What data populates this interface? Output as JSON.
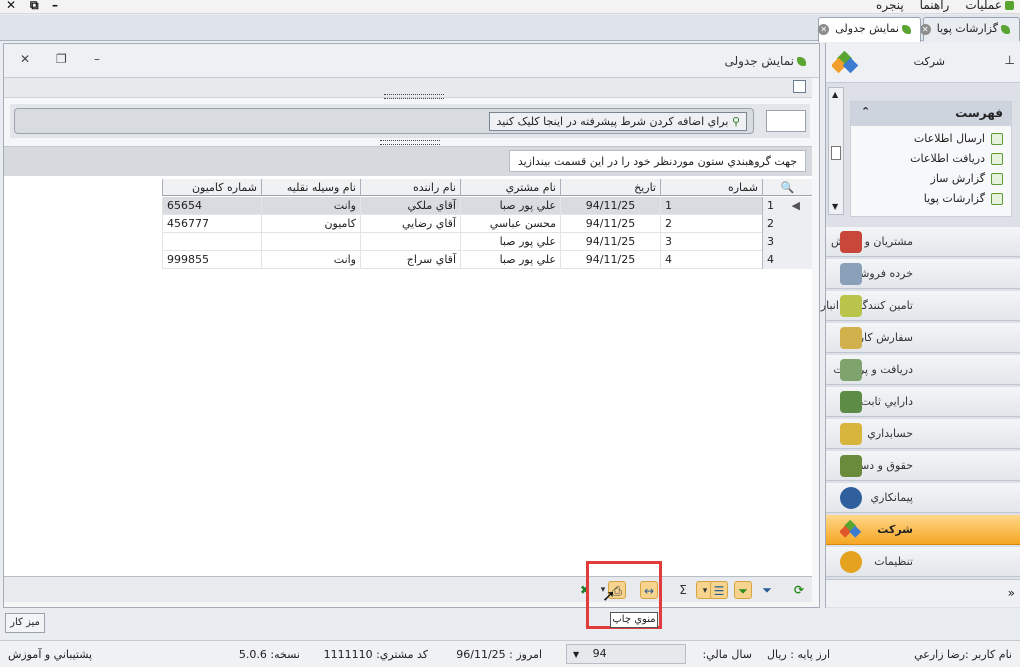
{
  "menubar": {
    "items": [
      "عملیات",
      "راهنما",
      "پنجره"
    ]
  },
  "tabs": [
    {
      "label": "گزارشات پویا"
    },
    {
      "label": "نمایش جدولی"
    }
  ],
  "window": {
    "title": "نمایش جدولی",
    "filter_button": "براي اضافه کردن شرط پيشرفته در اينجا کليک کنيد",
    "group_hint": "جهت گروهبندي ستون موردنظر خود را در اين قسمت بيندازيد"
  },
  "grid": {
    "columns": [
      "شماره",
      "تاريخ",
      "نام مشتري",
      "نام راننده",
      "نام وسيله نقليه",
      "شماره کاميون"
    ],
    "rows": [
      {
        "rownum": "1",
        "num": "1",
        "date": "94/11/25",
        "customer": "علي پور صبا",
        "driver": "آقاي ملکي",
        "vehicle": "وانت",
        "truck": "65654"
      },
      {
        "rownum": "2",
        "num": "2",
        "date": "94/11/25",
        "customer": "محسن عباسي",
        "driver": "آقاي رضايي",
        "vehicle": "کاميون",
        "truck": "456777"
      },
      {
        "rownum": "3",
        "num": "3",
        "date": "94/11/25",
        "customer": "علي پور صبا",
        "driver": "",
        "vehicle": "",
        "truck": ""
      },
      {
        "rownum": "4",
        "num": "4",
        "date": "94/11/25",
        "customer": "علي پور صبا",
        "driver": "آقاي سراج",
        "vehicle": "وانت",
        "truck": "999855"
      }
    ]
  },
  "toolbar": {
    "tooltip": "منوي چاپ",
    "sum_symbol": "Σ"
  },
  "right_panel": {
    "title": "شرکت",
    "list_header": "فهرست",
    "list_items": [
      "ارسال اطلاعات",
      "دريافت اطلاعات",
      "گزارش ساز",
      "گزارشات پويا"
    ],
    "nav_items": [
      {
        "label": "مشتريان و فروش"
      },
      {
        "label": "خرده فروشي"
      },
      {
        "label": "تامين کنندگان و انبار"
      },
      {
        "label": "سفارش کار"
      },
      {
        "label": "دريافت و پرداخت"
      },
      {
        "label": "دارايي ثابت"
      },
      {
        "label": "حسابداري"
      },
      {
        "label": "حقوق و دستمزد"
      },
      {
        "label": "پيمانکاري"
      },
      {
        "label": "شرکت"
      },
      {
        "label": "تنظيمات"
      }
    ]
  },
  "desktop_tab": "ميز کار",
  "status": {
    "user": "نام کاربر :رضا زارعي",
    "currency": "ارز پايه :    ريال",
    "fiscal_year_label": "سال مالي:",
    "fiscal_year": "94",
    "today": "امروز :    96/11/25",
    "customer_code": "کد مشتري:    1111110",
    "version": "نسخه:    5.0.6",
    "support": "پشتيباني و آموزش"
  },
  "colors": {
    "accent": "#f6a623",
    "highlight": "#e23b3b",
    "brand_green": "#57a52f"
  }
}
